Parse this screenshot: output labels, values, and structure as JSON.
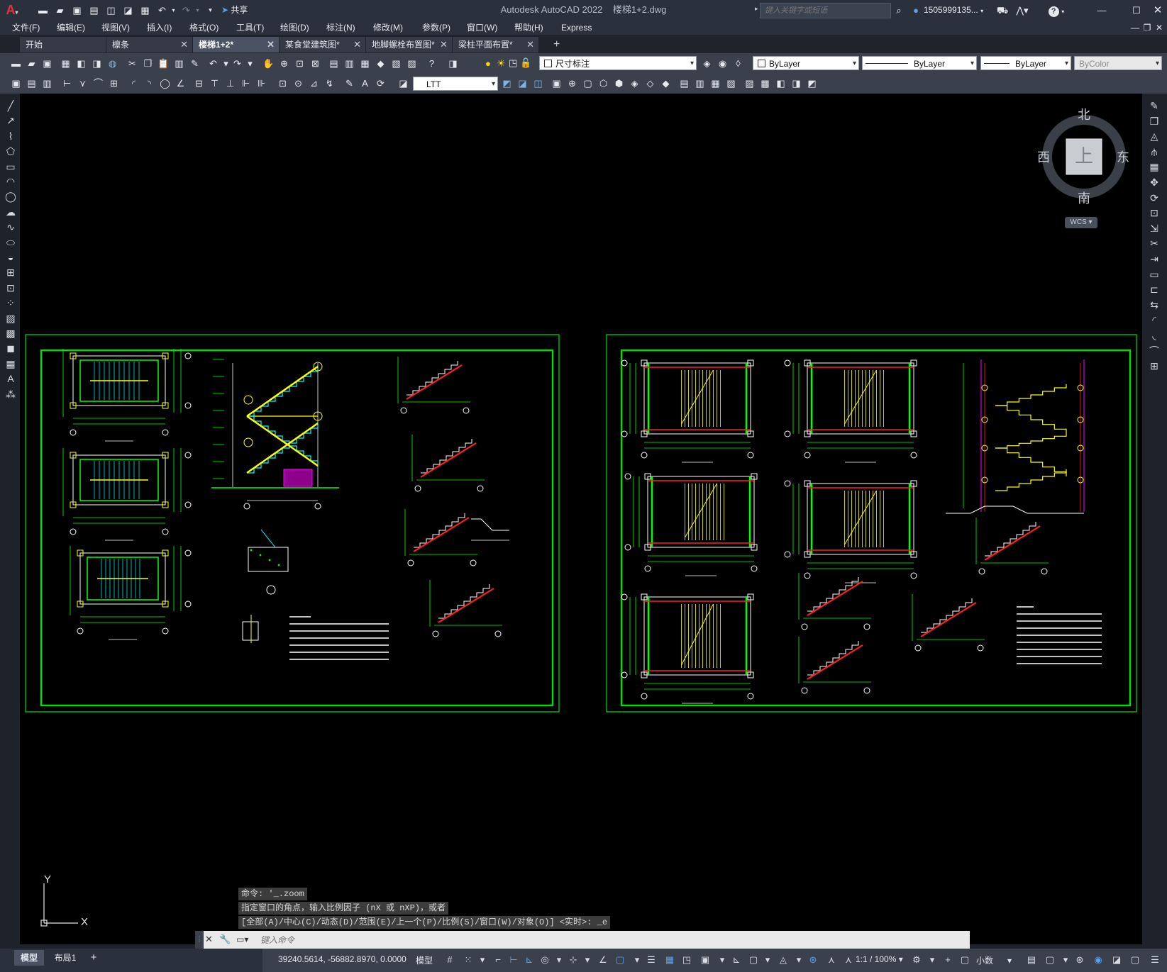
{
  "app": {
    "title": "Autodesk AutoCAD 2022",
    "filename": "楼梯1+2.dwg",
    "logo_letter": "A",
    "share_label": "共享",
    "search_placeholder": "键入关键字或短语",
    "user": "1505999135...",
    "help_symbol": "?"
  },
  "menus": [
    "文件(F)",
    "编辑(E)",
    "视图(V)",
    "插入(I)",
    "格式(O)",
    "工具(T)",
    "绘图(D)",
    "标注(N)",
    "修改(M)",
    "参数(P)",
    "窗口(W)",
    "帮助(H)",
    "Express"
  ],
  "tabs": [
    {
      "label": "开始",
      "active": false,
      "closable": false
    },
    {
      "label": "檩条",
      "active": false,
      "closable": true
    },
    {
      "label": "楼梯1+2*",
      "active": true,
      "closable": true
    },
    {
      "label": "某食堂建筑图*",
      "active": false,
      "closable": true
    },
    {
      "label": "地脚螺栓布置图*",
      "active": false,
      "closable": true
    },
    {
      "label": "梁柱平面布置*",
      "active": false,
      "closable": true
    }
  ],
  "toolbar": {
    "layer_value": "尺寸标注",
    "color_value": "ByLayer",
    "linetype_value": "ByLayer",
    "lineweight_value": "ByLayer",
    "plotstyle_value": "ByColor",
    "ltt_value": "LTT"
  },
  "navcube": {
    "north": "北",
    "south": "南",
    "east": "东",
    "west": "西",
    "face": "上",
    "wcs": "WCS"
  },
  "ucs": {
    "x": "X",
    "y": "Y"
  },
  "command": {
    "history": [
      "命令: '_.zoom",
      "指定窗口的角点，输入比例因子 (nX 或 nXP)，或者",
      "[全部(A)/中心(C)/动态(D)/范围(E)/上一个(P)/比例(S)/窗口(W)/对象(O)] <实时>: _e"
    ],
    "placeholder": "键入命令"
  },
  "status": {
    "model_tab": "模型",
    "layout_tab": "布局1",
    "add_tab": "+",
    "coordinates": "39240.5614, -56882.8970, 0.0000",
    "space": "模型",
    "scale": "1:1 / 100%",
    "units": "小数"
  },
  "colors": {
    "sheet_border": "#00e000",
    "canvas": "#000000",
    "accent_red": "#e8323a",
    "accent_blue": "#2f8fe0"
  },
  "sheets": [
    {
      "name": "stair-structure-sheet-1"
    },
    {
      "name": "stair-structure-sheet-2"
    }
  ]
}
